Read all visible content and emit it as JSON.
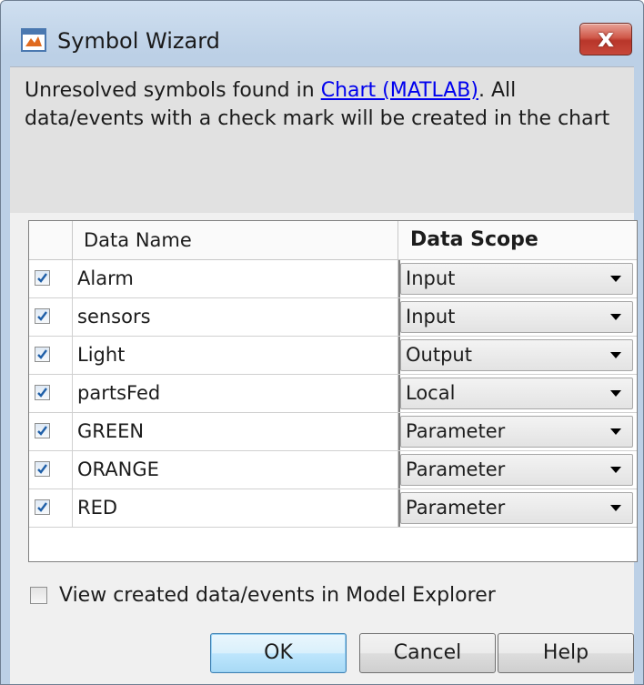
{
  "window": {
    "title": "Symbol Wizard",
    "close_glyph": "x",
    "app_icon": "matlab-window-icon",
    "close_icon": "close-icon"
  },
  "message": {
    "prefix": "Unresolved symbols found in ",
    "link": "Chart (MATLAB)",
    "suffix": ". All data/events with a check mark will be created in the chart"
  },
  "table": {
    "headers": [
      "",
      "Data Name",
      "Data Scope"
    ],
    "rows": [
      {
        "checked": true,
        "name": "Alarm",
        "scope": "Input"
      },
      {
        "checked": true,
        "name": "sensors",
        "scope": "Input"
      },
      {
        "checked": true,
        "name": "Light",
        "scope": "Output"
      },
      {
        "checked": true,
        "name": "partsFed",
        "scope": "Local"
      },
      {
        "checked": true,
        "name": "GREEN",
        "scope": "Parameter"
      },
      {
        "checked": true,
        "name": "ORANGE",
        "scope": "Parameter"
      },
      {
        "checked": true,
        "name": "RED",
        "scope": "Parameter"
      }
    ]
  },
  "option": {
    "label": "View created data/events in Model Explorer",
    "checked": false
  },
  "buttons": {
    "ok": "OK",
    "cancel": "Cancel",
    "help": "Help"
  },
  "colors": {
    "link": "#0000ee",
    "close": "#c7473a",
    "default_button": "#bee6fd"
  }
}
